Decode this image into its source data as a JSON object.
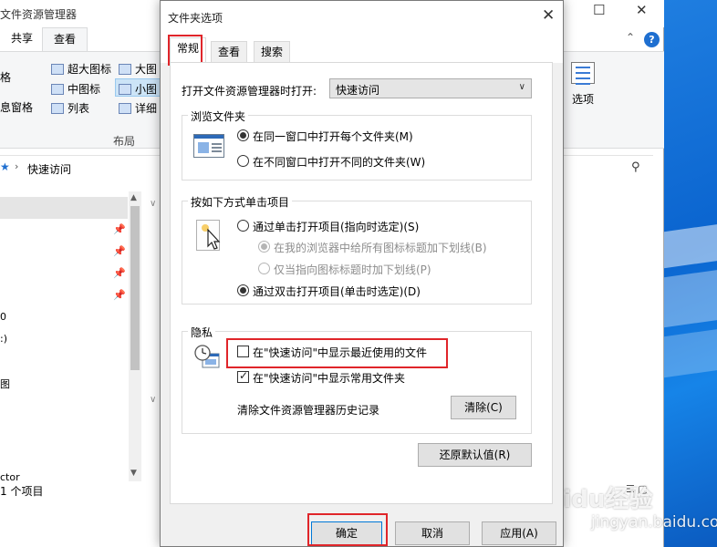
{
  "explorer": {
    "title": "文件资源管理器",
    "window_controls": {
      "minimize": "—",
      "maximize": "☐",
      "close": "✕"
    },
    "tabs": [
      "共享",
      "查看"
    ],
    "active_tab": "查看",
    "ribbon": {
      "left_items": [
        "格",
        "息窗格"
      ],
      "layout_items": [
        "超大图标",
        "大图",
        "中图标",
        "小图",
        "列表",
        "详细"
      ],
      "layout_group_label": "布局",
      "options_label": "选项"
    },
    "address": {
      "path": "快速访问"
    },
    "nav_texts": [
      "0",
      ":)",
      "图",
      "ctor"
    ],
    "status": "1 个项目"
  },
  "dialog": {
    "title": "文件夹选项",
    "close": "✕",
    "tabs": [
      "常规",
      "查看",
      "搜索"
    ],
    "active_tab": "常规",
    "open_explorer_label": "打开文件资源管理器时打开:",
    "open_explorer_value": "快速访问",
    "browse_group": {
      "title": "浏览文件夹",
      "options": [
        "在同一窗口中打开每个文件夹(M)",
        "在不同窗口中打开不同的文件夹(W)"
      ],
      "selected": 0
    },
    "click_group": {
      "title": "按如下方式单击项目",
      "options": [
        "通过单击打开项目(指向时选定)(S)",
        "在我的浏览器中给所有图标标题加下划线(B)",
        "仅当指向图标标题时加下划线(P)",
        "通过双击打开项目(单击时选定)(D)"
      ],
      "selected": 3
    },
    "privacy_group": {
      "title": "隐私",
      "show_recent_files": {
        "label": "在\"快速访问\"中显示最近使用的文件",
        "checked": false
      },
      "show_frequent_folders": {
        "label": "在\"快速访问\"中显示常用文件夹",
        "checked": true
      },
      "clear_history_label": "清除文件资源管理器历史记录",
      "clear_button": "清除(C)"
    },
    "restore_defaults": "还原默认值(R)",
    "buttons": {
      "ok": "确定",
      "cancel": "取消",
      "apply": "应用(A)"
    }
  },
  "watermark": {
    "brand": "Baidu经验",
    "url": "jingyan.baidu.com"
  },
  "colors": {
    "highlight_box": "#e0252a",
    "accent": "#0078d7"
  }
}
